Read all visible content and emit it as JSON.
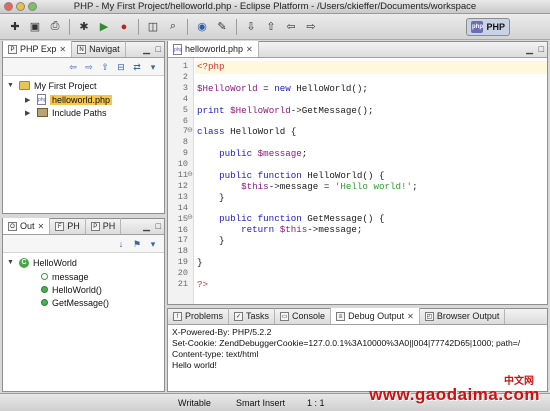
{
  "window": {
    "title": "PHP - My First Project/helloworld.php - Eclipse Platform - /Users/ckieffer/Documents/workspace"
  },
  "toolbar": {
    "perspective_label": "PHP",
    "icons": [
      "new-icon",
      "save-icon",
      "print-icon",
      "debug-icon",
      "run-icon",
      "external-tools-icon",
      "search-icon",
      "open-type-icon",
      "back-icon",
      "forward-icon"
    ]
  },
  "explorer": {
    "tabs": [
      {
        "label": "PHP Exp"
      },
      {
        "label": "Navigat"
      }
    ],
    "tree": {
      "project": "My First Project",
      "file": "helloworld.php",
      "include": "Include Paths"
    }
  },
  "outline": {
    "tabs": [
      {
        "label": "Out"
      },
      {
        "label": "PH"
      },
      {
        "label": "PH"
      }
    ],
    "tree": {
      "class": "HelloWorld",
      "members": [
        "message",
        "HelloWorld()",
        "GetMessage()"
      ]
    }
  },
  "editor": {
    "tab_label": "helloworld.php",
    "line_numbers": [
      "1",
      "2",
      "3",
      "4",
      "5",
      "6",
      "7",
      "8",
      "9",
      "10",
      "11",
      "12",
      "13",
      "14",
      "15",
      "16",
      "17",
      "18",
      "19",
      "20",
      "21"
    ]
  },
  "console": {
    "tabs": [
      {
        "label": "Problems"
      },
      {
        "label": "Tasks"
      },
      {
        "label": "Console"
      },
      {
        "label": "Debug Output"
      },
      {
        "label": "Browser Output"
      }
    ],
    "lines": [
      "X-Powered-By: PHP/5.2.2",
      "Set-Cookie: ZendDebuggerCookie=127.0.0.1%3A10000%3A0||004|77742D65|1000; path=/",
      "Content-type: text/html",
      "",
      "Hello world!"
    ]
  },
  "status": {
    "writable": "Writable",
    "insert_mode": "Smart Insert",
    "position": "1 : 1"
  },
  "watermark": {
    "text": "www.gaodaima.com",
    "cn": "中文网"
  },
  "colors": {
    "selection": "#f5c64a",
    "keyword": "#1b1bc6",
    "variable": "#8f1b7d",
    "string": "#2a9c2a"
  }
}
